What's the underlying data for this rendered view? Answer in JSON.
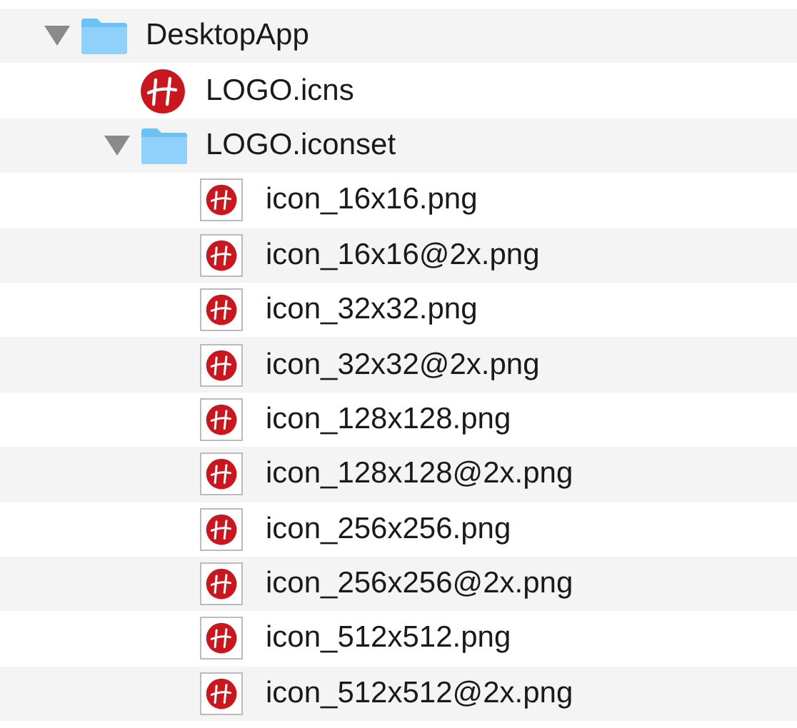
{
  "tree": [
    {
      "name": "DesktopApp",
      "kind": "folder",
      "expanded": true,
      "children": [
        {
          "name": "LOGO.icns",
          "kind": "icns"
        },
        {
          "name": "LOGO.iconset",
          "kind": "folder",
          "expanded": true,
          "children": [
            {
              "name": "icon_16x16.png",
              "kind": "png"
            },
            {
              "name": "icon_16x16@2x.png",
              "kind": "png"
            },
            {
              "name": "icon_32x32.png",
              "kind": "png"
            },
            {
              "name": "icon_32x32@2x.png",
              "kind": "png"
            },
            {
              "name": "icon_128x128.png",
              "kind": "png"
            },
            {
              "name": "icon_128x128@2x.png",
              "kind": "png"
            },
            {
              "name": "icon_256x256.png",
              "kind": "png"
            },
            {
              "name": "icon_256x256@2x.png",
              "kind": "png"
            },
            {
              "name": "icon_512x512.png",
              "kind": "png"
            },
            {
              "name": "icon_512x512@2x.png",
              "kind": "png"
            }
          ]
        }
      ]
    }
  ]
}
